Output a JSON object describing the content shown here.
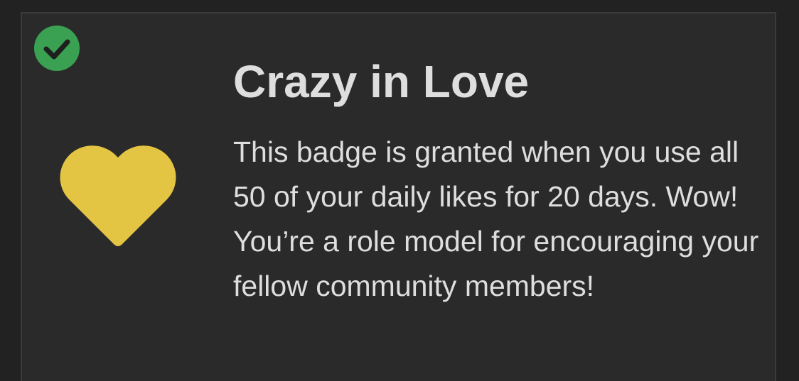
{
  "badge": {
    "title": "Crazy in Love",
    "description": "This badge is granted when you use all 50 of your daily likes for 20 days. Wow! You’re a role model for encouraging your fellow community members!",
    "icon": "heart-icon",
    "icon_color": "#e3c443",
    "granted": true,
    "granted_icon": "checkmark-icon",
    "granted_color": "#3aa152"
  }
}
